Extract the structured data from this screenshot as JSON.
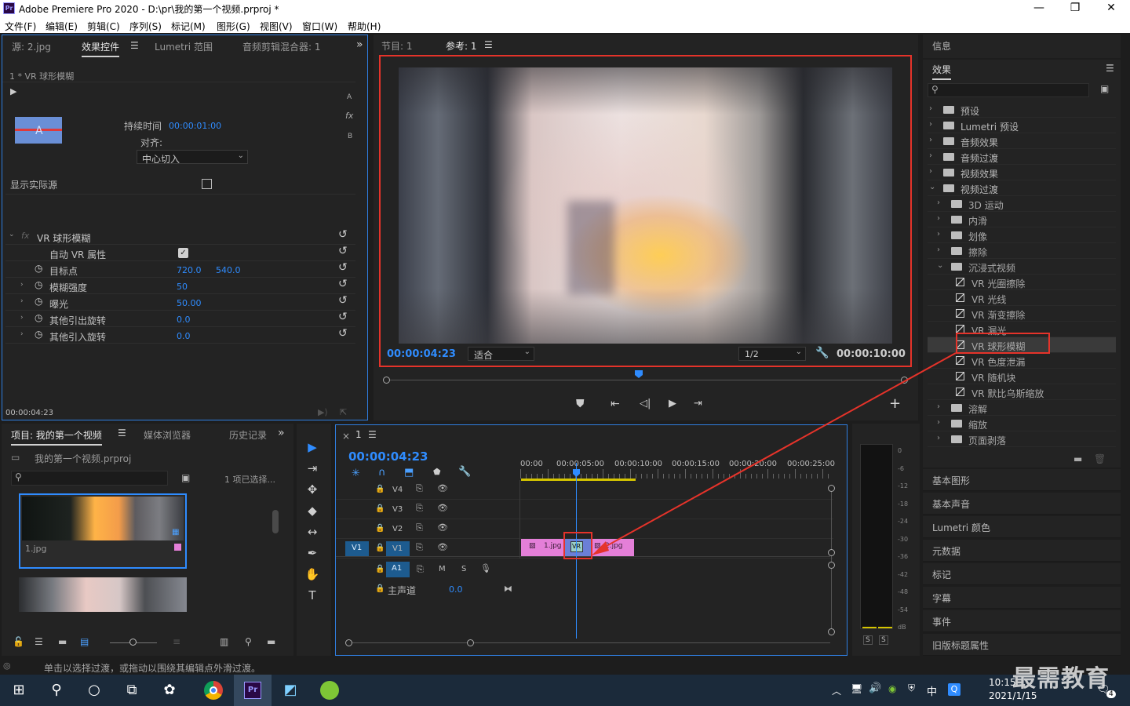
{
  "window": {
    "title": "Adobe Premiere Pro 2020 - D:\\pr\\我的第一个视频.prproj *",
    "app_badge": "Pr",
    "minimize": "—",
    "maximize": "❐",
    "close": "✕"
  },
  "menu": [
    "文件(F)",
    "编辑(E)",
    "剪辑(C)",
    "序列(S)",
    "标记(M)",
    "图形(G)",
    "视图(V)",
    "窗口(W)",
    "帮助(H)"
  ],
  "effect_controls": {
    "tabs": [
      "源: 2.jpg",
      "效果控件",
      "Lumetri 范围",
      "音频剪辑混合器: 1"
    ],
    "menu_glyph": "☰",
    "more_glyph": "»",
    "clip_header": "1 * VR 球形模糊",
    "duration_label": "持续时间",
    "duration_value": "00:00:01:00",
    "align_label": "对齐:",
    "align_value": "中心切入",
    "side_a": "A",
    "side_fx": "fx",
    "side_b": "B",
    "show_source": "显示实际源",
    "fx_badge": "fx",
    "effect_name": "VR 球形模糊",
    "props": [
      {
        "name": "自动 VR 属性",
        "value": "",
        "value2": "",
        "checkbox": true,
        "stopwatch": false,
        "expand": false
      },
      {
        "name": "目标点",
        "value": "720.0",
        "value2": "540.0",
        "checkbox": false,
        "stopwatch": true,
        "expand": false
      },
      {
        "name": "模糊强度",
        "value": "50",
        "value2": "",
        "checkbox": false,
        "stopwatch": true,
        "expand": true
      },
      {
        "name": "曝光",
        "value": "50.00",
        "value2": "",
        "checkbox": false,
        "stopwatch": true,
        "expand": true
      },
      {
        "name": "其他引出旋转",
        "value": "0.0",
        "value2": "",
        "checkbox": false,
        "stopwatch": true,
        "expand": true
      },
      {
        "name": "其他引入旋转",
        "value": "0.0",
        "value2": "",
        "checkbox": false,
        "stopwatch": true,
        "expand": true
      }
    ],
    "timecode": "00:00:04:23"
  },
  "program_monitor": {
    "tabs": [
      "节目: 1",
      "参考: 1"
    ],
    "timecode": "00:00:04:23",
    "fit": "适合",
    "resolution": "1/2",
    "duration": "00:00:10:00",
    "add_glyph": "+"
  },
  "effects_panel": {
    "info_title": "信息",
    "title": "效果",
    "menu_glyph": "☰",
    "items": [
      {
        "label": "预设",
        "level": 0,
        "expanded": false,
        "type": "folder"
      },
      {
        "label": "Lumetri 预设",
        "level": 0,
        "expanded": false,
        "type": "folder"
      },
      {
        "label": "音频效果",
        "level": 0,
        "expanded": false,
        "type": "folder"
      },
      {
        "label": "音频过渡",
        "level": 0,
        "expanded": false,
        "type": "folder"
      },
      {
        "label": "视频效果",
        "level": 0,
        "expanded": false,
        "type": "folder"
      },
      {
        "label": "视频过渡",
        "level": 0,
        "expanded": true,
        "type": "folder"
      },
      {
        "label": "3D 运动",
        "level": 1,
        "expanded": false,
        "type": "folder"
      },
      {
        "label": "内滑",
        "level": 1,
        "expanded": false,
        "type": "folder"
      },
      {
        "label": "划像",
        "level": 1,
        "expanded": false,
        "type": "folder"
      },
      {
        "label": "擦除",
        "level": 1,
        "expanded": false,
        "type": "folder"
      },
      {
        "label": "沉浸式视频",
        "level": 1,
        "expanded": true,
        "type": "folder"
      },
      {
        "label": "VR 光圈擦除",
        "level": 2,
        "expanded": false,
        "type": "fx"
      },
      {
        "label": "VR 光线",
        "level": 2,
        "expanded": false,
        "type": "fx"
      },
      {
        "label": "VR 渐变擦除",
        "level": 2,
        "expanded": false,
        "type": "fx"
      },
      {
        "label": "VR 漏光",
        "level": 2,
        "expanded": false,
        "type": "fx"
      },
      {
        "label": "VR 球形模糊",
        "level": 2,
        "expanded": false,
        "type": "fx",
        "selected": true
      },
      {
        "label": "VR 色度泄漏",
        "level": 2,
        "expanded": false,
        "type": "fx"
      },
      {
        "label": "VR 随机块",
        "level": 2,
        "expanded": false,
        "type": "fx"
      },
      {
        "label": "VR 默比乌斯缩放",
        "level": 2,
        "expanded": false,
        "type": "fx"
      },
      {
        "label": "溶解",
        "level": 1,
        "expanded": false,
        "type": "folder"
      },
      {
        "label": "缩放",
        "level": 1,
        "expanded": false,
        "type": "folder"
      },
      {
        "label": "页面剥落",
        "level": 1,
        "expanded": false,
        "type": "folder"
      }
    ],
    "side_panels": [
      "基本图形",
      "基本声音",
      "Lumetri 颜色",
      "元数据",
      "标记",
      "字幕",
      "事件",
      "旧版标题属性"
    ]
  },
  "project_panel": {
    "tabs": [
      "项目: 我的第一个视频",
      "媒体浏览器",
      "历史记录"
    ],
    "menu_glyph": "☰",
    "more_glyph": "»",
    "file_name": "我的第一个视频.prproj",
    "selection_info": "1 项已选择...",
    "thumb1_label": "1.jpg"
  },
  "tools": [
    "▶",
    "⇥",
    "✥",
    "◆",
    "↔",
    "✒",
    "✋",
    "T"
  ],
  "timeline": {
    "tab": "1",
    "close_glyph": "×",
    "menu_glyph": "☰",
    "timecode": "00:00:04:23",
    "ruler": [
      "00:00",
      "00:00:05:00",
      "00:00:10:00",
      "00:00:15:00",
      "00:00:20:00",
      "00:00:25:00"
    ],
    "video_tracks": [
      "V4",
      "V3",
      "V2",
      "V1"
    ],
    "source_patch": "V1",
    "audio_track": "A1",
    "master_label": "主声道",
    "master_value": "0.0",
    "clip1": "1.jpg",
    "clip2": "2.jpg",
    "transition_label": "VR",
    "mute": "M",
    "solo": "S"
  },
  "audio_meter": {
    "scale": [
      "0",
      "-6",
      "-12",
      "-18",
      "-24",
      "-30",
      "-36",
      "-42",
      "-48",
      "-54",
      "dB"
    ],
    "solo_left": "S",
    "solo_right": "S"
  },
  "status_bar": {
    "text": "单击以选择过渡，或拖动以围绕其编辑点外滑过渡。"
  },
  "taskbar": {
    "time": "10:15",
    "date": "2021/1/15",
    "ime": "中",
    "watermark": "最需教育",
    "notification_count": "4"
  },
  "colors": {
    "accent_blue": "#2f8cff",
    "highlight_red": "#e5332a",
    "clip_pink": "#e47fd8",
    "panel_bg": "#232323",
    "app_bg": "#1d1d1d"
  }
}
